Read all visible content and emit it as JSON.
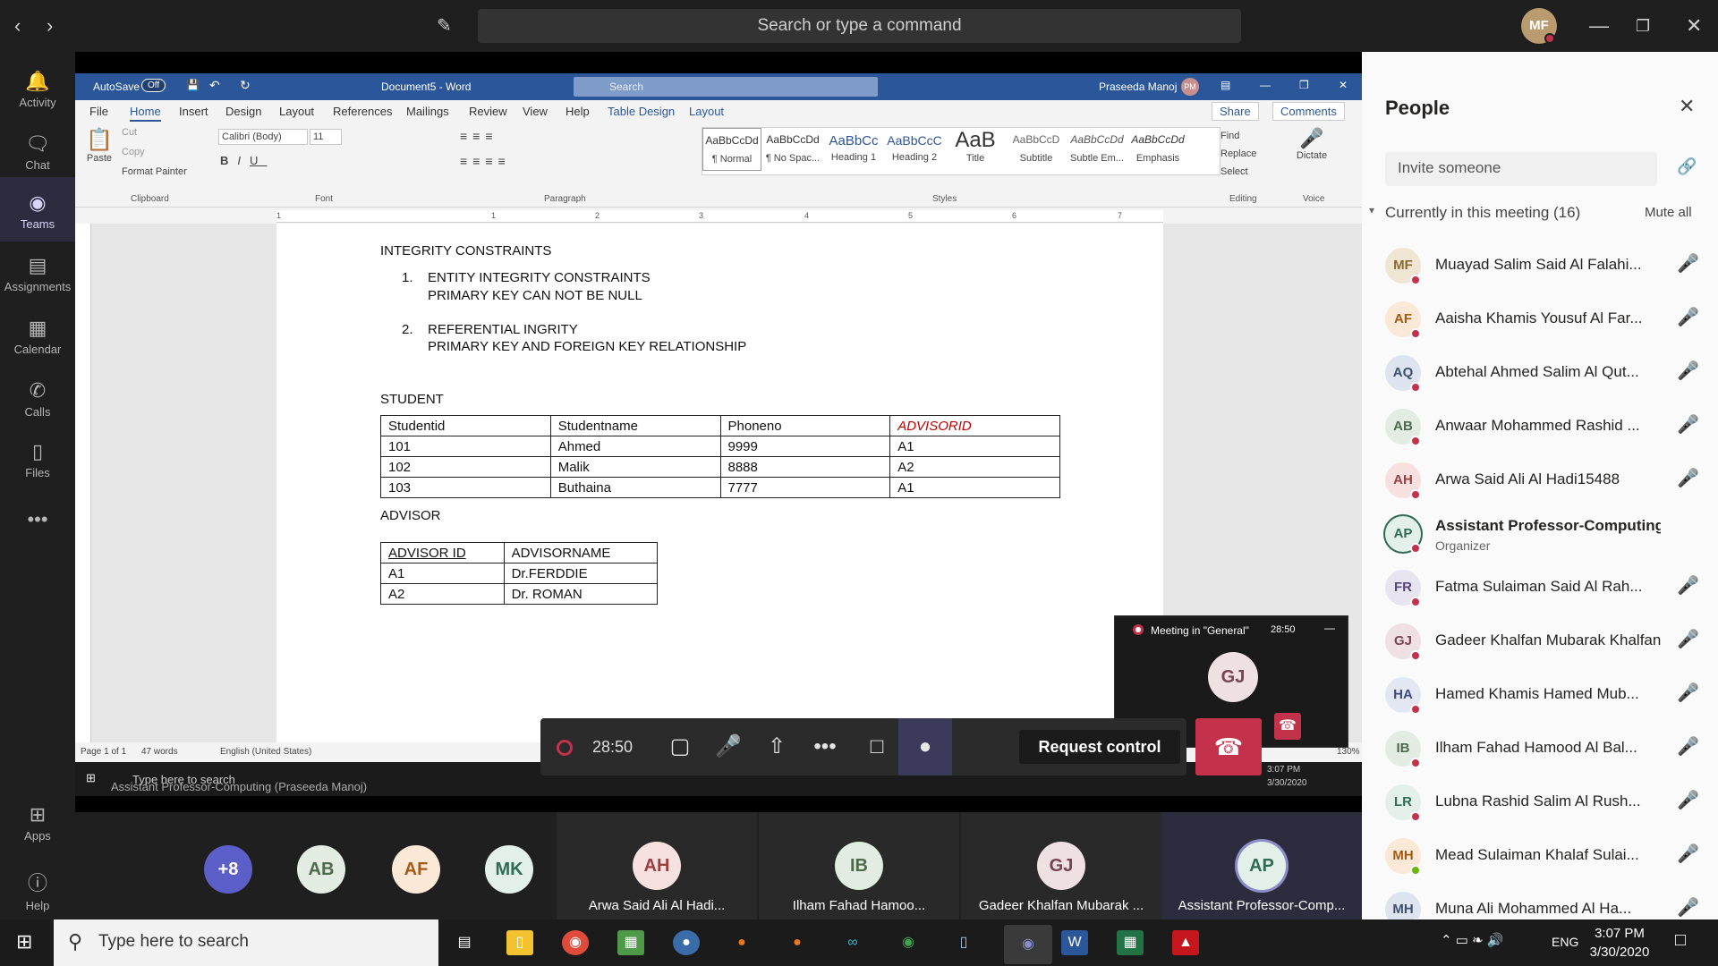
{
  "titlebar": {
    "search_placeholder": "Search or type a command",
    "avatar_initials": "MF"
  },
  "rail": [
    {
      "label": "Activity",
      "icon": "bell-icon"
    },
    {
      "label": "Chat",
      "icon": "chat-icon"
    },
    {
      "label": "Teams",
      "icon": "teams-icon"
    },
    {
      "label": "Assignments",
      "icon": "backpack-icon"
    },
    {
      "label": "Calendar",
      "icon": "calendar-icon"
    },
    {
      "label": "Calls",
      "icon": "phone-icon"
    },
    {
      "label": "Files",
      "icon": "file-icon"
    },
    {
      "label": "Apps",
      "icon": "apps-icon"
    },
    {
      "label": "Help",
      "icon": "help-icon"
    }
  ],
  "word": {
    "autosave": "AutoSave",
    "autosave_state": "Off",
    "doc_title": "Document5 - Word",
    "search": "Search",
    "user": "Praseeda Manoj",
    "user_initials": "PM",
    "menu": [
      "File",
      "Home",
      "Insert",
      "Design",
      "Layout",
      "References",
      "Mailings",
      "Review",
      "View",
      "Help",
      "Table Design",
      "Layout"
    ],
    "share": "Share",
    "comments": "Comments",
    "clipboard": {
      "paste": "Paste",
      "cut": "Cut",
      "copy": "Copy",
      "format_painter": "Format Painter",
      "label": "Clipboard"
    },
    "font": {
      "name": "Calibri (Body)",
      "size": "11",
      "label": "Font"
    },
    "paragraph_label": "Paragraph",
    "styles": [
      {
        "sample": "AaBbCcDd",
        "name": "¶ Normal"
      },
      {
        "sample": "AaBbCcDd",
        "name": "¶ No Spac..."
      },
      {
        "sample": "AaBbCc",
        "name": "Heading 1"
      },
      {
        "sample": "AaBbCcC",
        "name": "Heading 2"
      },
      {
        "sample": "AaB",
        "name": "Title"
      },
      {
        "sample": "AaBbCcD",
        "name": "Subtitle"
      },
      {
        "sample": "AaBbCcDd",
        "name": "Subtle Em..."
      },
      {
        "sample": "AaBbCcDd",
        "name": "Emphasis"
      }
    ],
    "styles_label": "Styles",
    "editing": {
      "find": "Find",
      "replace": "Replace",
      "select": "Select",
      "label": "Editing"
    },
    "voice": {
      "dictate": "Dictate",
      "label": "Voice"
    },
    "ruler": [
      "1",
      "1",
      "2",
      "3",
      "4",
      "5",
      "6",
      "7"
    ],
    "document": {
      "heading": "INTEGRITY CONSTRAINTS",
      "item1_num": "1.",
      "item1_title": "ENTITY INTEGRITY CONSTRAINTS",
      "item1_desc": "PRIMARY KEY CAN NOT BE NULL",
      "item2_num": "2.",
      "item2_title": "REFERENTIAL INGRITY",
      "item2_desc": "PRIMARY KEY AND FOREIGN KEY RELATIONSHIP",
      "student_label": "STUDENT",
      "student_headers": [
        "Studentid",
        "Studentname",
        "Phoneno",
        "ADVISORID"
      ],
      "student_rows": [
        [
          "101",
          "Ahmed",
          "9999",
          "A1"
        ],
        [
          "102",
          "Malik",
          "8888",
          "A2"
        ],
        [
          "103",
          "Buthaina",
          "7777",
          "A1"
        ]
      ],
      "advisor_label": "ADVISOR",
      "advisor_headers": [
        "ADVISOR ID",
        "ADVISORNAME"
      ],
      "advisor_rows": [
        [
          "A1",
          "Dr.FERDDIE"
        ],
        [
          "A2",
          "Dr. ROMAN"
        ]
      ]
    },
    "status": {
      "page": "Page 1 of 1",
      "words": "47 words",
      "lang": "English (United States)",
      "zoom": "130%"
    },
    "inner_taskbar": {
      "search": "Type here to search",
      "presenter": "Assistant Professor-Computing (Praseeda Manoj)",
      "time": "3:07 PM",
      "date": "3/30/2020"
    }
  },
  "call": {
    "timer": "28:50",
    "request_control": "Request control"
  },
  "mini_meeting": {
    "title": "Meeting in \"General\"",
    "timer": "28:50",
    "initials": "GJ"
  },
  "gallery": {
    "overflow": "+8",
    "avatars": [
      "AB",
      "AF",
      "MK"
    ],
    "tiles": [
      {
        "initials": "AH",
        "name": "Arwa Said Ali Al Hadi..."
      },
      {
        "initials": "IB",
        "name": "Ilham Fahad Hamoo..."
      },
      {
        "initials": "GJ",
        "name": "Gadeer Khalfan Mubarak ..."
      },
      {
        "initials": "AP",
        "name": "Assistant Professor-Comp..."
      }
    ]
  },
  "people": {
    "title": "People",
    "invite_placeholder": "Invite someone",
    "section": "Currently in this meeting (16)",
    "mute_all": "Mute all",
    "list": [
      {
        "initials": "MF",
        "name": "Muayad Salim Said Al Falahi...",
        "bg": "#efe5d3",
        "fg": "#8a6a2f"
      },
      {
        "initials": "AF",
        "name": "Aaisha Khamis Yousuf Al Far...",
        "bg": "#fbe8d6",
        "fg": "#a35a17"
      },
      {
        "initials": "AQ",
        "name": "Abtehal Ahmed Salim Al Qut...",
        "bg": "#dde4ef",
        "fg": "#3d4f6c"
      },
      {
        "initials": "AB",
        "name": "Anwaar Mohammed Rashid ...",
        "bg": "#e2ece2",
        "fg": "#4b6b4b"
      },
      {
        "initials": "AH",
        "name": "Arwa Said Ali Al Hadi15488",
        "bg": "#f7e0e0",
        "fg": "#9b3f3f"
      },
      {
        "initials": "AP",
        "name": "Assistant Professor-Computing ...",
        "sub": "Organizer",
        "bg": "#e3efe9",
        "fg": "#2f6b55"
      },
      {
        "initials": "FR",
        "name": "Fatma Sulaiman Said Al Rah...",
        "bg": "#e7e3ef",
        "fg": "#56467a"
      },
      {
        "initials": "GJ",
        "name": "Gadeer Khalfan Mubarak Khalfan ...",
        "bg": "#efe0e4",
        "fg": "#7a4352"
      },
      {
        "initials": "HA",
        "name": "Hamed Khamis Hamed Mub...",
        "bg": "#e3e7f2",
        "fg": "#3d4a7a"
      },
      {
        "initials": "IB",
        "name": "Ilham Fahad Hamood Al Bal...",
        "bg": "#e2ece2",
        "fg": "#4b6b4b"
      },
      {
        "initials": "LR",
        "name": "Lubna Rashid Salim Al Rush...",
        "bg": "#e3efe9",
        "fg": "#2f6b55"
      },
      {
        "initials": "MH",
        "name": "Mead Sulaiman Khalaf Sulai...",
        "bg": "#fbe8d6",
        "fg": "#a35a17"
      },
      {
        "initials": "MH",
        "name": "Muna Ali Mohammed Al Ha...",
        "bg": "#dde4ef",
        "fg": "#3d4f6c"
      }
    ]
  },
  "taskbar": {
    "search": "Type here to search",
    "lang": "ENG",
    "time": "3:07 PM",
    "date": "3/30/2020"
  },
  "colors": {
    "word_blue": "#2b579a",
    "teams_purple": "#6264a7",
    "hangup_red": "#c4314b",
    "presence_busy": "#c4314b"
  }
}
